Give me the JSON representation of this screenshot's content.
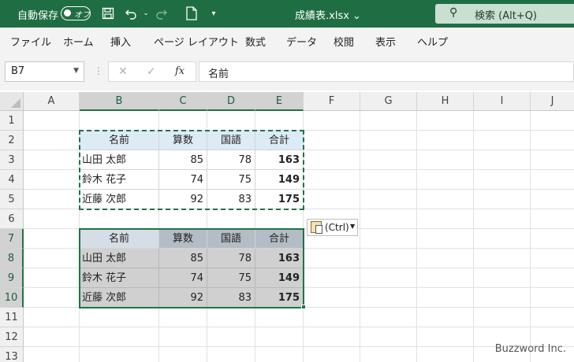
{
  "titlebar": {
    "autosave_label": "自動保存",
    "autosave_state": "オフ",
    "filename": "成績表.xlsx",
    "search_label": "検索 (Alt+Q)"
  },
  "ribbon": {
    "tabs": [
      "ファイル",
      "ホーム",
      "挿入",
      "ページ レイアウト",
      "数式",
      "データ",
      "校閲",
      "表示",
      "ヘルプ"
    ]
  },
  "formula_bar": {
    "name_box": "B7",
    "fx_symbol": "fx",
    "formula": "名前"
  },
  "sheet": {
    "columns": [
      "A",
      "B",
      "C",
      "D",
      "E",
      "F",
      "G",
      "H",
      "I",
      "J"
    ],
    "rows": [
      "1",
      "2",
      "3",
      "4",
      "5",
      "6",
      "7",
      "8",
      "9",
      "10",
      "11",
      "12",
      "13"
    ],
    "table1": {
      "headers": [
        "名前",
        "算数",
        "国語",
        "合計"
      ],
      "rows": [
        [
          "山田 太郎",
          "85",
          "78",
          "163"
        ],
        [
          "鈴木 花子",
          "74",
          "75",
          "149"
        ],
        [
          "近藤 次郎",
          "92",
          "83",
          "175"
        ]
      ]
    },
    "table2": {
      "headers": [
        "名前",
        "算数",
        "国語",
        "合計"
      ],
      "rows": [
        [
          "山田 太郎",
          "85",
          "78",
          "163"
        ],
        [
          "鈴木 花子",
          "74",
          "75",
          "149"
        ],
        [
          "近藤 次郎",
          "92",
          "83",
          "175"
        ]
      ]
    }
  },
  "paste_options": {
    "label": "(Ctrl)"
  },
  "watermark": "Buzzword Inc.",
  "colors": {
    "excel_green": "#217346",
    "header_fill": "#ddebf7"
  }
}
